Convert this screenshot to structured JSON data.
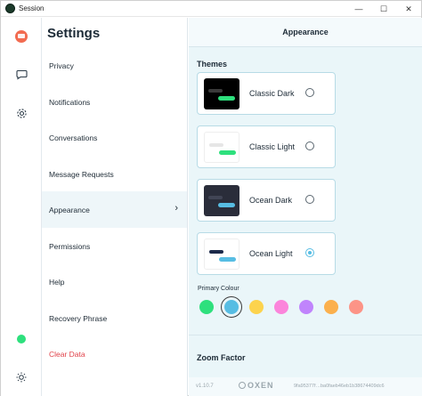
{
  "window": {
    "title": "Session",
    "minimize": "—",
    "maximize": "☐",
    "close": "✕"
  },
  "rail": {
    "icons": [
      "avatar-icon",
      "chat-icon",
      "gear-icon",
      "online-status-icon",
      "theme-toggle-icon"
    ]
  },
  "settings": {
    "title": "Settings",
    "items": [
      {
        "label": "Privacy"
      },
      {
        "label": "Notifications"
      },
      {
        "label": "Conversations"
      },
      {
        "label": "Message Requests"
      },
      {
        "label": "Appearance",
        "active": true
      },
      {
        "label": "Permissions"
      },
      {
        "label": "Help"
      },
      {
        "label": "Recovery Phrase"
      },
      {
        "label": "Clear Data",
        "danger": true
      }
    ],
    "active_chevron": "›"
  },
  "appearance": {
    "header": "Appearance",
    "themes_title": "Themes",
    "themes": [
      {
        "label": "Classic Dark",
        "bg": "#000000",
        "bar1": "#3a3a3a",
        "bar2": "#2ee07d",
        "selected": false
      },
      {
        "label": "Classic Light",
        "bg": "#ffffff",
        "bar1": "#e8e8e8",
        "bar2": "#2ee07d",
        "selected": false
      },
      {
        "label": "Ocean Dark",
        "bg": "#2a2d3a",
        "bar1": "#414555",
        "bar2": "#57bde3",
        "selected": false
      },
      {
        "label": "Ocean Light",
        "bg": "#ffffff",
        "bar1": "#1c2a4a",
        "bar2": "#57bde3",
        "selected": true
      }
    ],
    "primary_colour_label": "Primary Colour",
    "colours": [
      {
        "hex": "#2ee07d",
        "selected": false
      },
      {
        "hex": "#57bde3",
        "selected": true
      },
      {
        "hex": "#fcd34d",
        "selected": false
      },
      {
        "hex": "#fb85db",
        "selected": false
      },
      {
        "hex": "#c084fc",
        "selected": false
      },
      {
        "hex": "#fbb04d",
        "selected": false
      },
      {
        "hex": "#fc9487",
        "selected": false
      }
    ],
    "zoom_title": "Zoom Factor"
  },
  "footer": {
    "version": "v1.10.7",
    "brand": "OXEN",
    "commit": "9fa95377f…ba0faeb46eb1b38674409dc6"
  }
}
